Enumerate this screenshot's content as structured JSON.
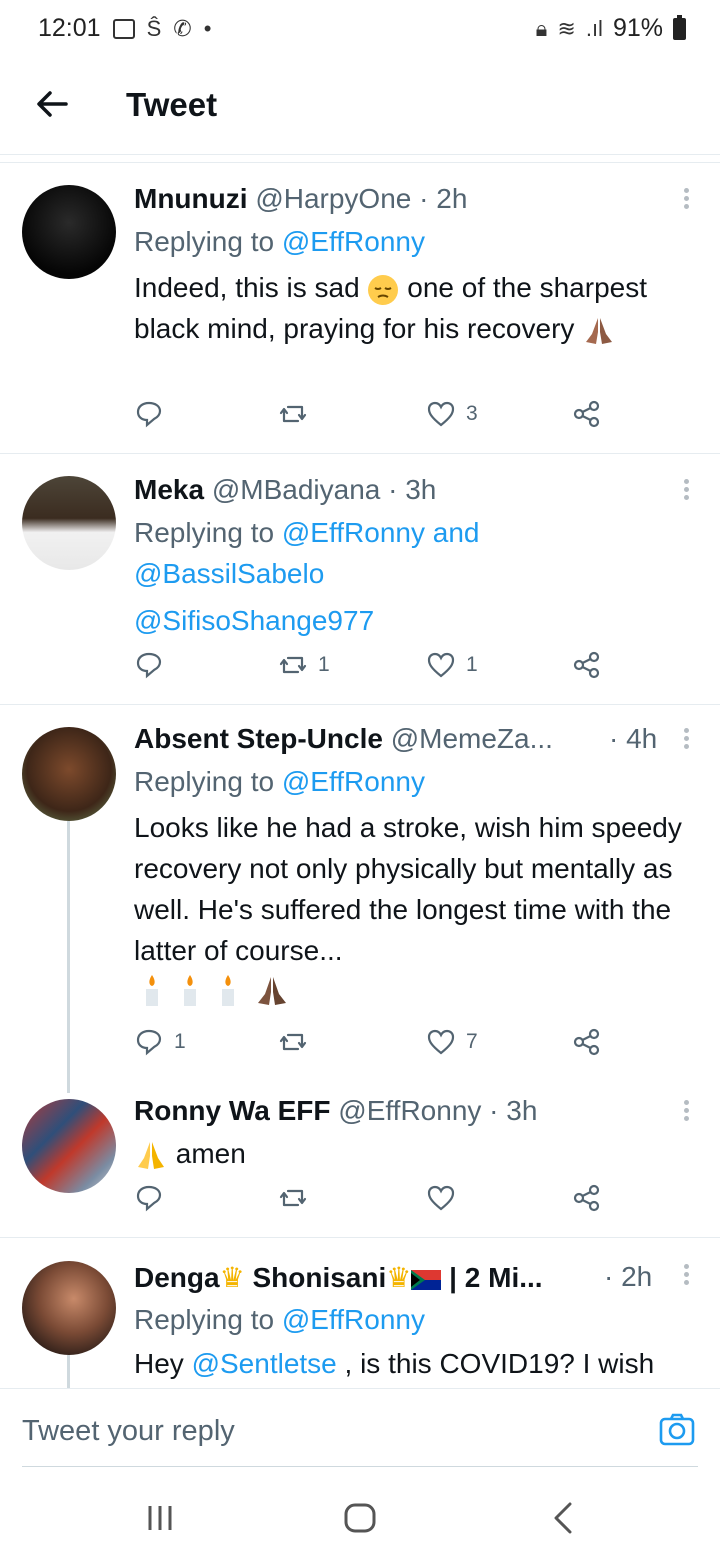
{
  "status": {
    "time": "12:01",
    "battery": "91%"
  },
  "appbar": {
    "title": "Tweet"
  },
  "tweets": [
    {
      "name": "Mnunuzi",
      "handle": "@HarpyOne",
      "time": "· 2h",
      "replying_prefix": "Replying to ",
      "replying_to": "@EffRonny",
      "text1": "Indeed, this is sad ",
      "text2": " one of the sharpest black mind, praying for his recovery ",
      "replies": "",
      "retweets": "",
      "likes": "3"
    },
    {
      "name": "Meka",
      "handle": "@MBadiyana",
      "time": "· 3h",
      "replying_prefix": "Replying to ",
      "replying_to": "@EffRonny",
      "replying_and": "and",
      "replying_to_2": "@BassilSabelo",
      "replying_to_3": "@SifisoShange977",
      "replies": "",
      "retweets": "1",
      "likes": "1"
    },
    {
      "name": "Absent Step-Uncle",
      "handle": "@MemeZa...",
      "time": "· 4h",
      "replying_prefix": "Replying to ",
      "replying_to": "@EffRonny",
      "text": "Looks like he had a stroke, wish him speedy recovery not only physically but mentally as well. He's suffered the longest time with the latter of course...",
      "replies": "1",
      "retweets": "",
      "likes": "7"
    },
    {
      "name": "Ronny Wa EFF",
      "handle": "@EffRonny",
      "time": "· 3h",
      "text": "amen",
      "replies": "",
      "retweets": "",
      "likes": ""
    },
    {
      "name": "Denga",
      "name2": "Shonisani",
      "name3": "| 2 Mi...",
      "time": "· 2h",
      "replying_prefix": "Replying to ",
      "replying_to": "@EffRonny",
      "text_prefix": "Hey ",
      "mention": "@Sentletse",
      "text_suffix": " , is this COVID19? I wish"
    }
  ],
  "reply": {
    "placeholder": "Tweet your reply"
  },
  "colors": {
    "link": "#1d9bf0",
    "muted": "#536471",
    "divider": "#e6ecf0"
  }
}
